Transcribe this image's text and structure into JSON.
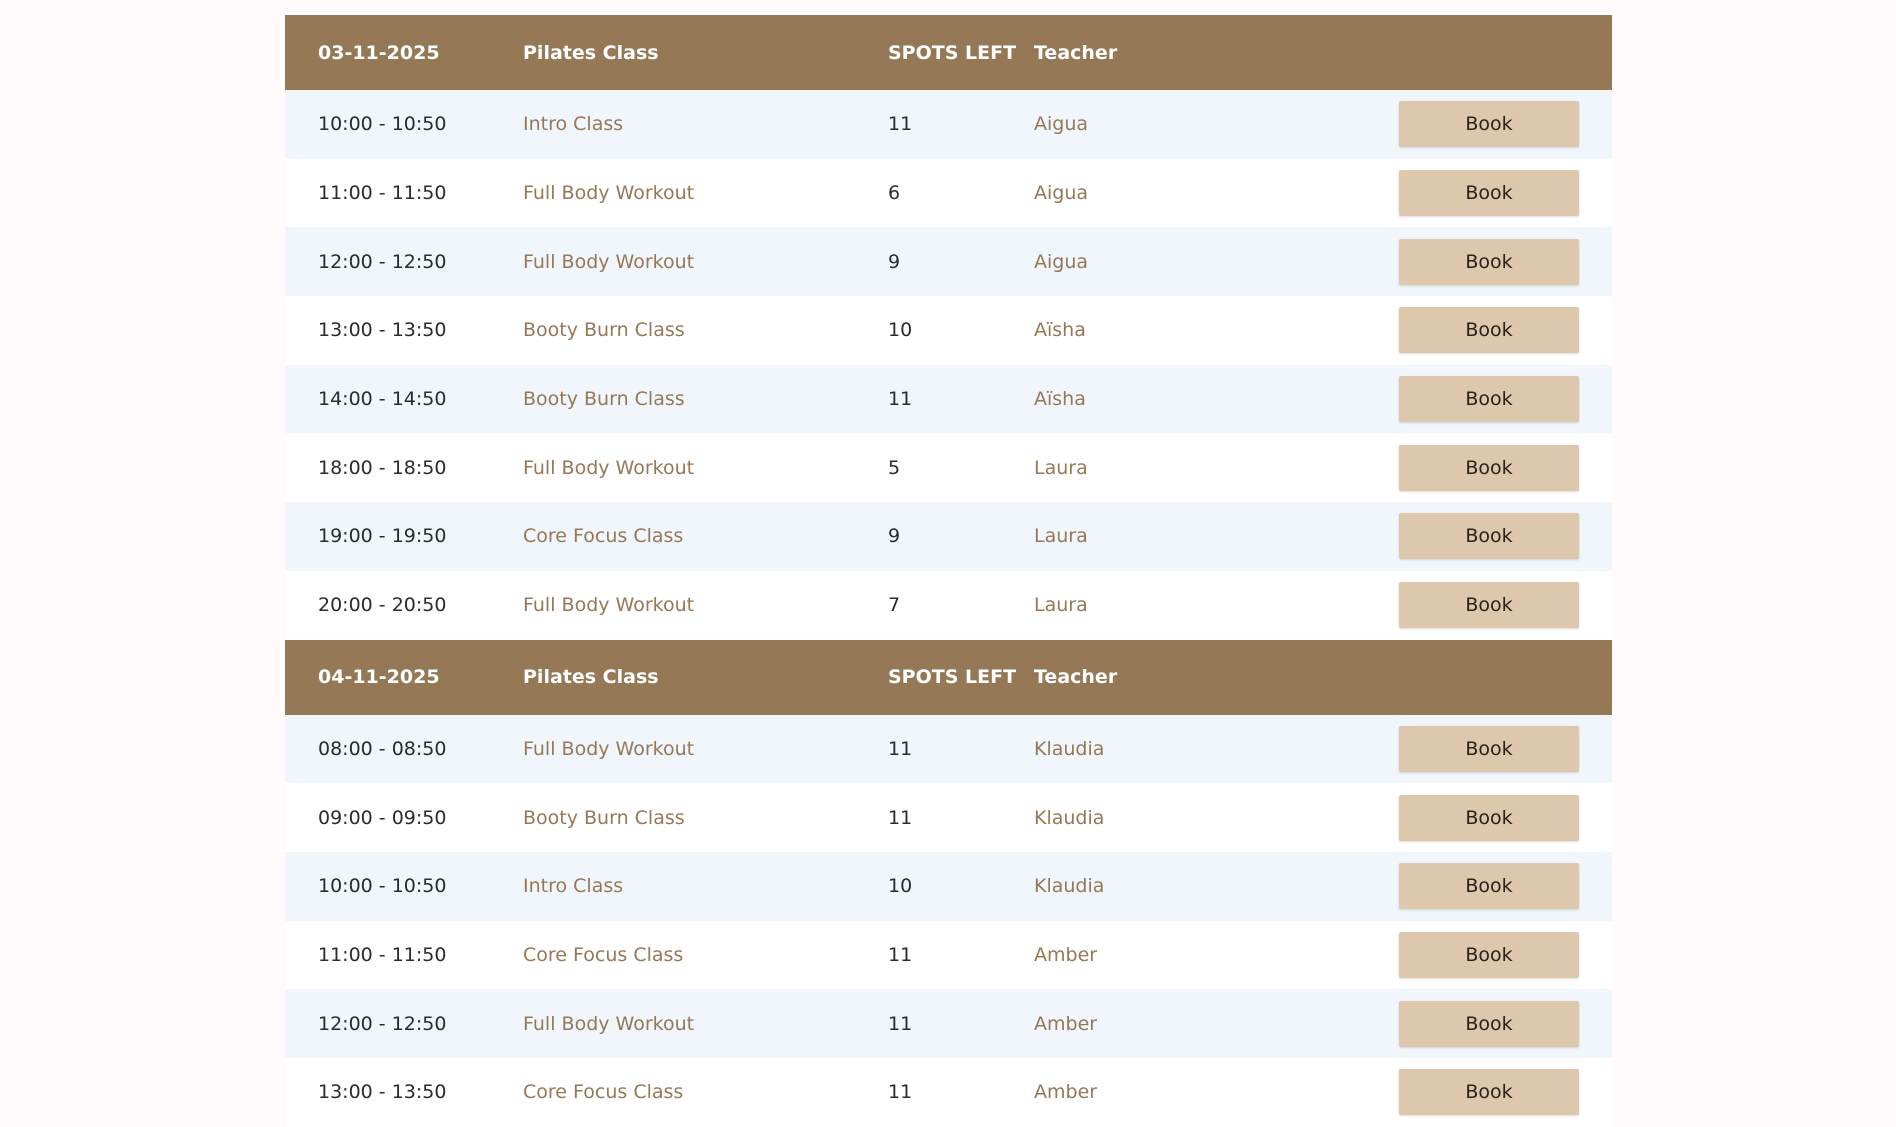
{
  "days": [
    {
      "date": "03-11-2025",
      "class_header": "Pilates Class",
      "spots_header": "SPOTS LEFT",
      "teacher_header": "Teacher",
      "rows": [
        {
          "time": "10:00 - 10:50",
          "class": "Intro Class",
          "spots": "11",
          "teacher": "Aigua",
          "button": "Book"
        },
        {
          "time": "11:00 - 11:50",
          "class": "Full Body Workout",
          "spots": "6",
          "teacher": "Aigua",
          "button": "Book"
        },
        {
          "time": "12:00 - 12:50",
          "class": "Full Body Workout",
          "spots": "9",
          "teacher": "Aigua",
          "button": "Book"
        },
        {
          "time": "13:00 - 13:50",
          "class": "Booty Burn Class",
          "spots": "10",
          "teacher": "Aïsha",
          "button": "Book"
        },
        {
          "time": "14:00 - 14:50",
          "class": "Booty Burn Class",
          "spots": "11",
          "teacher": "Aïsha",
          "button": "Book"
        },
        {
          "time": "18:00 - 18:50",
          "class": "Full Body Workout",
          "spots": "5",
          "teacher": "Laura",
          "button": "Book"
        },
        {
          "time": "19:00 - 19:50",
          "class": "Core Focus Class",
          "spots": "9",
          "teacher": "Laura",
          "button": "Book"
        },
        {
          "time": "20:00 - 20:50",
          "class": "Full Body Workout",
          "spots": "7",
          "teacher": "Laura",
          "button": "Book"
        }
      ]
    },
    {
      "date": "04-11-2025",
      "class_header": "Pilates Class",
      "spots_header": "SPOTS LEFT",
      "teacher_header": "Teacher",
      "rows": [
        {
          "time": "08:00 - 08:50",
          "class": "Full Body Workout",
          "spots": "11",
          "teacher": "Klaudia",
          "button": "Book"
        },
        {
          "time": "09:00 - 09:50",
          "class": "Booty Burn Class",
          "spots": "11",
          "teacher": "Klaudia",
          "button": "Book"
        },
        {
          "time": "10:00 - 10:50",
          "class": "Intro Class",
          "spots": "10",
          "teacher": "Klaudia",
          "button": "Book"
        },
        {
          "time": "11:00 - 11:50",
          "class": "Core Focus Class",
          "spots": "11",
          "teacher": "Amber",
          "button": "Book"
        },
        {
          "time": "12:00 - 12:50",
          "class": "Full Body Workout",
          "spots": "11",
          "teacher": "Amber",
          "button": "Book"
        },
        {
          "time": "13:00 - 13:50",
          "class": "Core Focus Class",
          "spots": "11",
          "teacher": "Amber",
          "button": "Book"
        }
      ]
    }
  ],
  "colors": {
    "header_bg": "#957855",
    "row_alt_bg": "#f1f6fd",
    "button_bg": "#ddc8ad",
    "accent_text": "#957855"
  }
}
